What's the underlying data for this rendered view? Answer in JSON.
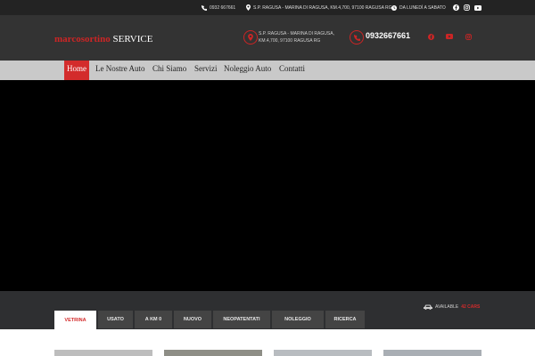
{
  "topbar": {
    "phone": "0932 667661",
    "address": "S.P. RAGUSA - MARINA DI RAGUSA, KM.4,700, 97100 RAGUSA RG",
    "hours": "DA LUNEDÌ A SABATO"
  },
  "header": {
    "logo_part1": "marcosortino",
    "logo_part2": "SERVICE",
    "address_line1": "S.P. RAGUSA - MARINA DI RAGUSA,",
    "address_line2": "KM.4,700, 97100 RAGUSA RG",
    "phone": "0932667661"
  },
  "nav": {
    "items": [
      "Home",
      "Le Nostre Auto",
      "Chi Siamo",
      "Servizi",
      "Noleggio Auto",
      "Contatti"
    ]
  },
  "tabs": {
    "items": [
      "VETRINA",
      "USATO",
      "A KM 0",
      "NUOVO",
      "NEOPATENTATI",
      "NOLEGGIO",
      "RICERCA"
    ]
  },
  "available": {
    "label": "AVAILABLE",
    "count": "42 CARS"
  },
  "colors": {
    "accent": "#d32b2b",
    "topbar": "#232323",
    "header": "#333333",
    "nav": "#c9c9c9",
    "band": "#2e2f31"
  }
}
